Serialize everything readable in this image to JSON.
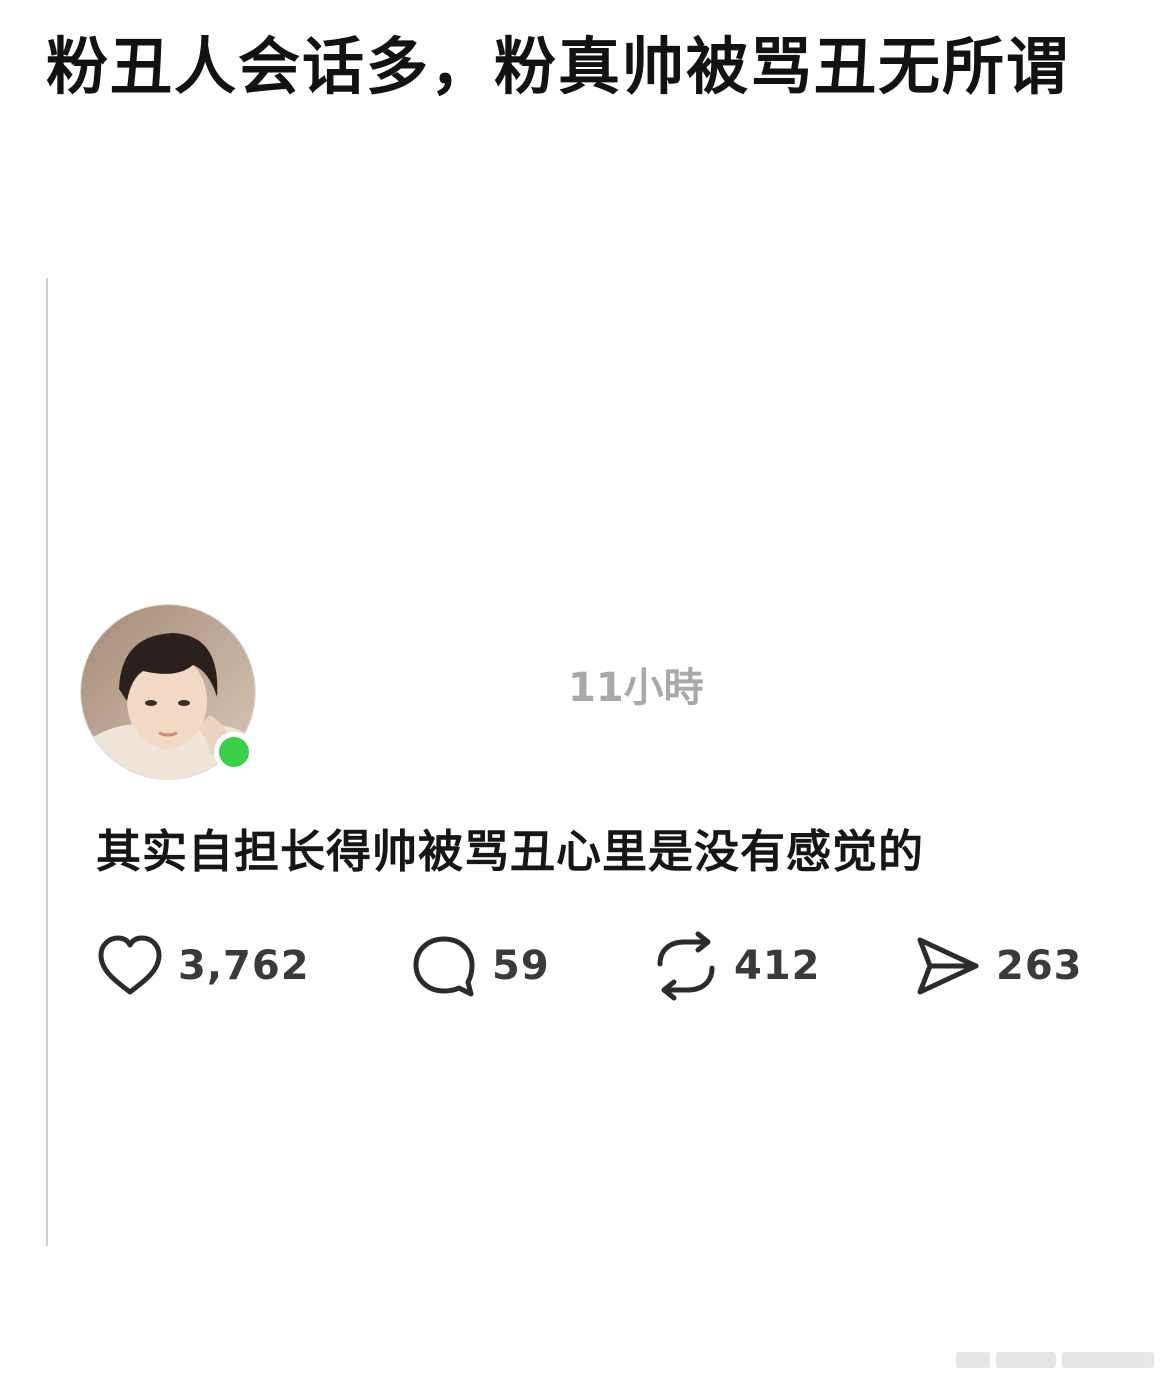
{
  "header": {
    "title": "粉丑人会话多，粉真帅被骂丑无所谓"
  },
  "post": {
    "time": "11小時",
    "text": "其实自担长得帅被骂丑心里是没有感觉的",
    "online_status_color": "#3ad04a"
  },
  "actions": {
    "likes": {
      "icon": "heart-icon",
      "count": "3,762"
    },
    "comments": {
      "icon": "comment-bubble-icon",
      "count": "59"
    },
    "reposts": {
      "icon": "repost-arrows-icon",
      "count": "412"
    },
    "shares": {
      "icon": "send-plane-icon",
      "count": "263"
    }
  }
}
